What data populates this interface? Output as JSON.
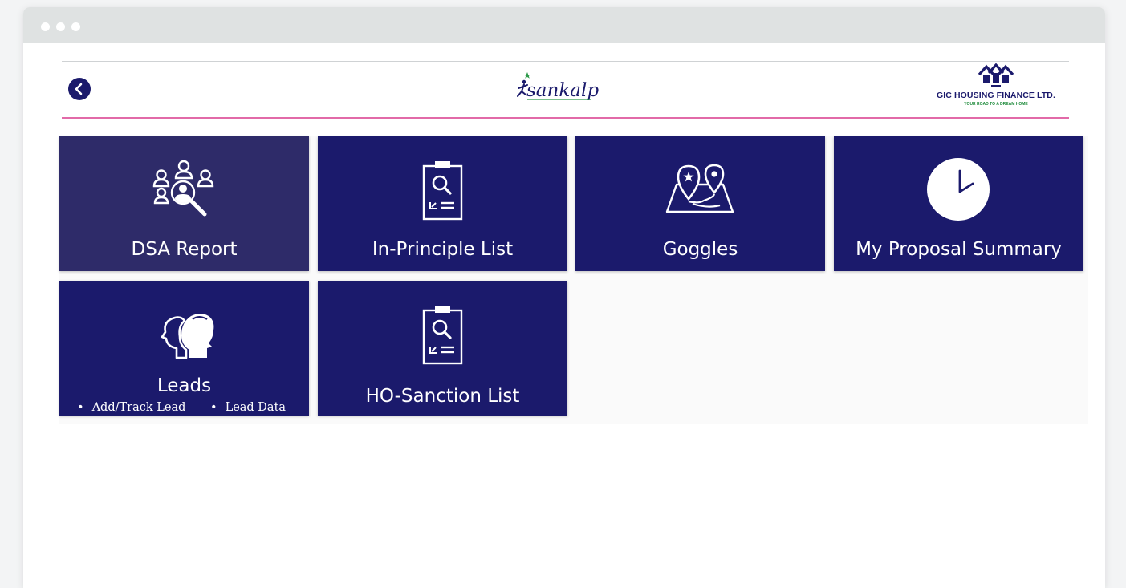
{
  "header": {
    "back_icon": "chevron-left-icon",
    "center_logo_text": "sankalp",
    "brand_logo": {
      "name": "GIC HOUSING FINANCE LTD.",
      "tagline": "YOUR ROAD TO A DREAM HOME"
    }
  },
  "tiles": [
    {
      "label": "DSA Report",
      "icon": "people-search-icon"
    },
    {
      "label": "In-Principle List",
      "icon": "clipboard-search-icon"
    },
    {
      "label": "Goggles",
      "icon": "map-pin-icon"
    },
    {
      "label": "My Proposal Summary",
      "icon": "clock-icon"
    },
    {
      "label": "Leads",
      "icon": "heads-profile-icon",
      "subitems": [
        "Add/Track Lead",
        "Lead Data"
      ]
    },
    {
      "label": "HO-Sanction List",
      "icon": "clipboard-search-icon"
    }
  ],
  "colors": {
    "tile": "#1b1a6c",
    "tile_active": "#2e2b69",
    "header_divider": "#e26aa8",
    "titlebar": "#dfe2e2"
  }
}
